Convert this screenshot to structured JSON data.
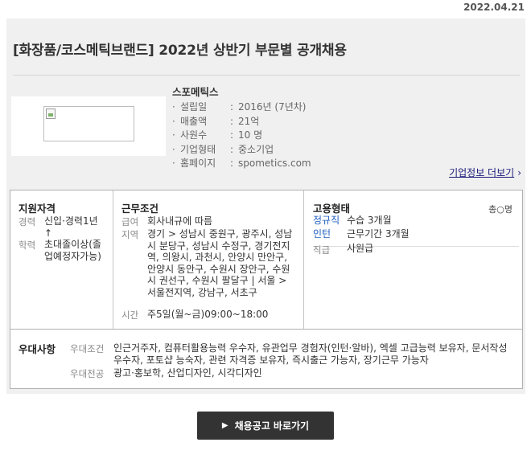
{
  "date": "2022.04.21",
  "posting": {
    "title": "[화장품/코스메틱브랜드] 2022년 상반기 부문별 공개채용"
  },
  "company": {
    "name": "스포메틱스",
    "info": [
      {
        "key": "설립일",
        "value": "2016년 (7년차)"
      },
      {
        "key": "매출액",
        "value": "21억"
      },
      {
        "key": "사원수",
        "value": "10 명"
      },
      {
        "key": "기업형태",
        "value": "중소기업"
      },
      {
        "key": "홈페이지",
        "value": "spometics.com"
      }
    ],
    "more_link": "기업정보 더보기"
  },
  "conditions": {
    "qualification": {
      "title": "지원자격",
      "career_label": "경력",
      "career_value": "신입·경력1년↑",
      "education_label": "학력",
      "education_value": "초대졸이상(졸업예정자가능)"
    },
    "work": {
      "title": "근무조건",
      "salary_label": "급여",
      "salary_value": "회사내규에 따름",
      "location_label": "지역",
      "location_value": "경기 > 성남시 중원구, 광주시, 성남시 분당구, 성남시 수정구, 경기전지역, 의왕시, 과천시, 안양시 만안구, 안양시 동안구, 수원시 장안구, 수원시 권선구, 수원시 팔달구 | 서울 > 서울전지역, 강남구, 서초구",
      "time_label": "시간",
      "time_value": "주5일(월~금)09:00~18:00"
    },
    "employment": {
      "title": "고용형태",
      "count": "총○명",
      "type1_label": "정규직",
      "type1_value": "수습 3개월",
      "type2_label": "인턴",
      "type2_value": "근무기간 3개월",
      "rank_label": "직급",
      "rank_value": "사원급"
    },
    "preference": {
      "title": "우대사항",
      "cond_label": "우대조건",
      "cond_value": "인근거주자, 컴퓨터활용능력 우수자, 유관업무 경험자(인턴·알바), 엑셀 고급능력 보유자, 문서작성 우수자, 포토샵 능숙자, 관련 자격증 보유자, 즉시출근 가능자, 장기근무 가능자",
      "major_label": "우대전공",
      "major_value": "광고·홍보학, 산업디자인, 시각디자인"
    }
  },
  "apply_button": "채용공고 바로가기"
}
